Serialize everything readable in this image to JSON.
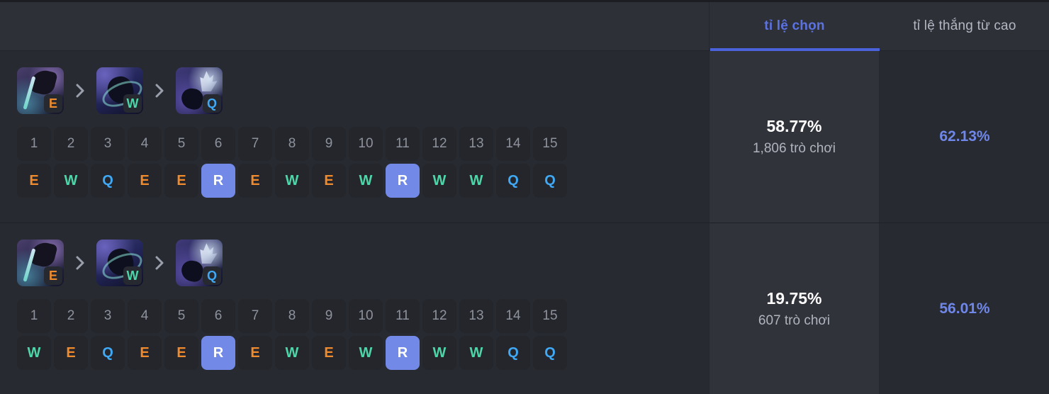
{
  "header": {
    "tabs": [
      {
        "label": "tỉ lệ chọn",
        "active": true
      },
      {
        "label": "tỉ lệ thắng từ cao",
        "active": false
      }
    ]
  },
  "colors": {
    "accent_blue": "#5b72e0",
    "underline_blue": "#4a63db",
    "ult_blue": "#7289e8",
    "q_blue": "#3fa9f5",
    "w_green": "#4dd6a8",
    "e_orange": "#ef8b2c",
    "win_rate_blue": "#6f87e8",
    "row_bg": "#282a31",
    "highlight_col_bg": "#31333b",
    "header_bg": "#2e3038",
    "cell_bg": "#24262c"
  },
  "levels": [
    "1",
    "2",
    "3",
    "4",
    "5",
    "6",
    "7",
    "8",
    "9",
    "10",
    "11",
    "12",
    "13",
    "14",
    "15"
  ],
  "rows": [
    {
      "priority": [
        {
          "key": "E",
          "icon": "ability-icon-e"
        },
        {
          "key": "W",
          "icon": "ability-icon-w"
        },
        {
          "key": "Q",
          "icon": "ability-icon-q"
        }
      ],
      "separator": "chevron-right-icon",
      "order": [
        "E",
        "W",
        "Q",
        "E",
        "E",
        "R",
        "E",
        "W",
        "E",
        "W",
        "R",
        "W",
        "W",
        "Q",
        "Q"
      ],
      "pick_rate": "58.77%",
      "games": "1,806 trò chơi",
      "win_rate": "62.13%"
    },
    {
      "priority": [
        {
          "key": "E",
          "icon": "ability-icon-e"
        },
        {
          "key": "W",
          "icon": "ability-icon-w"
        },
        {
          "key": "Q",
          "icon": "ability-icon-q"
        }
      ],
      "separator": "chevron-right-icon",
      "order": [
        "W",
        "E",
        "Q",
        "E",
        "E",
        "R",
        "E",
        "W",
        "E",
        "W",
        "R",
        "W",
        "W",
        "Q",
        "Q"
      ],
      "pick_rate": "19.75%",
      "games": "607 trò chơi",
      "win_rate": "56.01%"
    }
  ]
}
